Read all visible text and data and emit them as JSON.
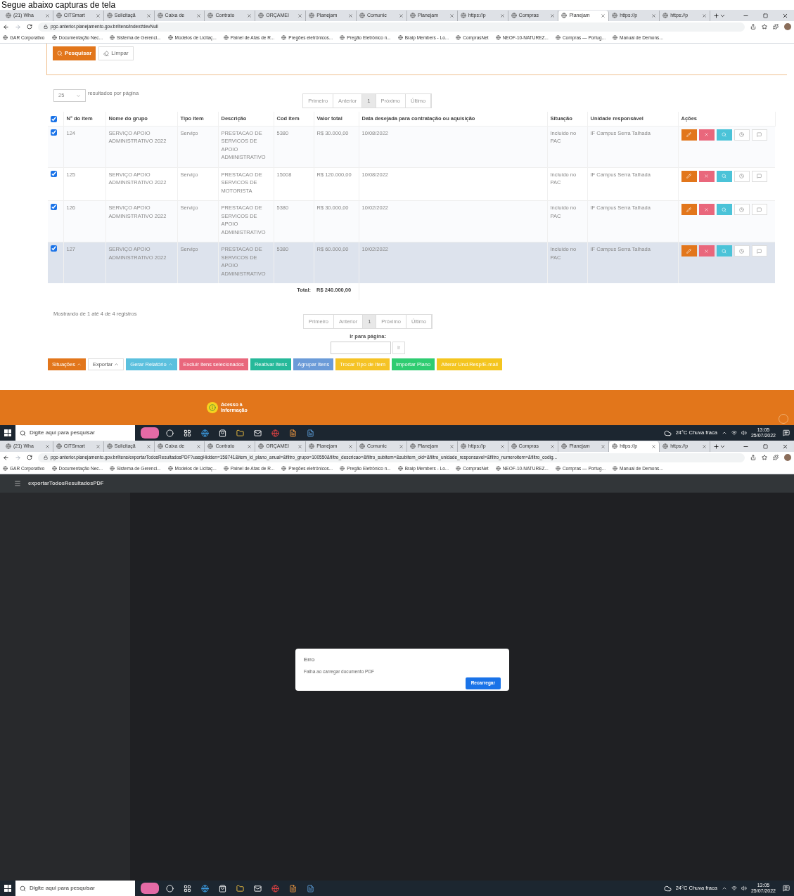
{
  "caption": "Segue abaixo capturas de tela",
  "screenshots": [
    {
      "browser": {
        "tabs": [
          {
            "label": "(21) Wha",
            "selected": false
          },
          {
            "label": "CITSmart",
            "selected": false
          },
          {
            "label": "Solicitaçã",
            "selected": false
          },
          {
            "label": "Caixa de",
            "selected": false
          },
          {
            "label": "Contrato",
            "selected": false
          },
          {
            "label": "ORÇAMEI",
            "selected": false
          },
          {
            "label": "Planejam",
            "selected": false
          },
          {
            "label": "Comunic",
            "selected": false
          },
          {
            "label": "Planejam",
            "selected": false
          },
          {
            "label": "https://p",
            "selected": false
          },
          {
            "label": "Compras",
            "selected": false
          },
          {
            "label": "Planejam",
            "selected": true
          },
          {
            "label": "https://p",
            "selected": false
          },
          {
            "label": "https://p",
            "selected": false
          }
        ],
        "url": "pgc-anterior.planejamento.gov.br/itens/index#devNull",
        "bookmarks": [
          "GAR Corporativo",
          "Documentação Nec...",
          "Sistema de Gerenci...",
          "Modelos de Licitaç...",
          "Painel de Atas de R...",
          "Pregões eletrônicos...",
          "Pregão Eletrônico n...",
          "Braip Members - Lo...",
          "ComprasNet",
          "NEOF-10-NATUREZ...",
          "Compras — Portug...",
          "Manual de Demons..."
        ]
      },
      "page": {
        "kind": "items",
        "search_buttons": [
          "Pesquisar",
          "Limpar"
        ],
        "page_size": "25",
        "page_size_label": "resultados por página",
        "pagination": [
          {
            "label": "Primeiro",
            "selected": false
          },
          {
            "label": "Anterior",
            "selected": false
          },
          {
            "label": "1",
            "selected": true
          },
          {
            "label": "Próximo",
            "selected": false
          },
          {
            "label": "Último",
            "selected": false
          }
        ],
        "table": {
          "select_all_checked": true,
          "columns": [
            "N° do item",
            "Nome do grupo",
            "Tipo item",
            "Descrição",
            "Cod item",
            "Valor total",
            "Data desejada para contratação ou aquisição",
            "Situação",
            "Unidade responsável",
            "Ações"
          ],
          "rows": [
            {
              "checked": true,
              "highlighted": false,
              "cells": [
                "124",
                "SERVIÇO APOIO ADMINISTRATIVO 2022",
                "Serviço",
                "PRESTACAO DE SERVICOS DE APOIO ADMINISTRATIVO",
                "5380",
                "R$ 30.000,00",
                "10/08/2022",
                "Incluído no PAC",
                "IF Campus Serra Talhada"
              ]
            },
            {
              "checked": true,
              "highlighted": false,
              "cells": [
                "125",
                "SERVIÇO APOIO ADMINISTRATIVO 2022",
                "Serviço",
                "PRESTACAO DE SERVICOS DE MOTORISTA",
                "15008",
                "R$ 120.000,00",
                "10/08/2022",
                "Incluído no PAC",
                "IF Campus Serra Talhada"
              ]
            },
            {
              "checked": true,
              "highlighted": false,
              "cells": [
                "126",
                "SERVIÇO APOIO ADMINISTRATIVO 2022",
                "Serviço",
                "PRESTACAO DE SERVICOS DE APOIO ADMINISTRATIVO",
                "5380",
                "R$ 30.000,00",
                "10/02/2022",
                "Incluído no PAC",
                "IF Campus Serra Talhada"
              ]
            },
            {
              "checked": true,
              "highlighted": true,
              "cells": [
                "127",
                "SERVIÇO APOIO ADMINISTRATIVO 2022",
                "Serviço",
                "PRESTACAO DE SERVICOS DE APOIO ADMINISTRATIVO",
                "5380",
                "R$ 60.000,00",
                "10/02/2022",
                "Incluído no PAC",
                "IF Campus Serra Talhada"
              ]
            }
          ],
          "total_label": "Total:",
          "total_value": "R$ 240.000,00"
        },
        "showing": "Mostrando de 1 até 4 de 4 registros",
        "pagination_bottom": [
          {
            "label": "Primeiro",
            "selected": false
          },
          {
            "label": "Anterior",
            "selected": false
          },
          {
            "label": "1",
            "selected": true
          },
          {
            "label": "Próximo",
            "selected": false
          },
          {
            "label": "Último",
            "selected": false
          }
        ],
        "goto_label": "Ir para página:",
        "goto_button": "Ir",
        "actions": [
          {
            "label": "Situações",
            "color": "#e2761b",
            "dropdown": true
          },
          {
            "label": "Exportar",
            "color": "#ffffff",
            "dropdown": true
          },
          {
            "label": "Gerar Relatório",
            "color": "#5bc0de",
            "dropdown": true
          },
          {
            "label": "Excluir itens selecionados",
            "color": "#e9677c",
            "dropdown": false
          },
          {
            "label": "Reativar Itens",
            "color": "#26b99a",
            "dropdown": false
          },
          {
            "label": "Agrupar Itens",
            "color": "#6b9bd8",
            "dropdown": false
          },
          {
            "label": "Trocar Tipo de Item",
            "color": "#f5c325",
            "dropdown": false
          },
          {
            "label": "Importar Plano",
            "color": "#2ecc71",
            "dropdown": false
          },
          {
            "label": "Alterar Und.Resp/E-mail",
            "color": "#f4c51f",
            "dropdown": false
          }
        ],
        "footer_link": "Acesso à Informação"
      },
      "taskbar": {
        "search": "Digite aqui para pesquisar",
        "weather": "24°C Chuva fraca",
        "time": "13:05",
        "date": "25/07/2022"
      }
    },
    {
      "browser": {
        "tabs": [
          {
            "label": "(21) Wha",
            "selected": false
          },
          {
            "label": "CITSmart",
            "selected": false
          },
          {
            "label": "Solicitaçã",
            "selected": false
          },
          {
            "label": "Caixa de",
            "selected": false
          },
          {
            "label": "Contrato",
            "selected": false
          },
          {
            "label": "ORÇAMEI",
            "selected": false
          },
          {
            "label": "Planejam",
            "selected": false
          },
          {
            "label": "Comunic",
            "selected": false
          },
          {
            "label": "Planejam",
            "selected": false
          },
          {
            "label": "https://p",
            "selected": false
          },
          {
            "label": "Compras",
            "selected": false
          },
          {
            "label": "Planejam",
            "selected": false
          },
          {
            "label": "https://p",
            "selected": true
          },
          {
            "label": "https://p",
            "selected": false
          }
        ],
        "url": "pgc-anterior.planejamento.gov.br/itens/exportarTodosResultadosPDF?uasgHidden=158741&item_id_plano_anual=&filtro_grupo=100550&filtro_descricao=&filtro_subitem=&subitem_old=&filtro_unidade_responsavel=&filtro_numeroitem=&filtro_codig...",
        "bookmarks": [
          "GAR Corporativo",
          "Documentação Nec...",
          "Sistema de Gerenci...",
          "Modelos de Licitaç...",
          "Painel de Atas de R...",
          "Pregões eletrônicos...",
          "Pregão Eletrônico n...",
          "Braip Members - Lo...",
          "ComprasNet",
          "NEOF-10-NATUREZ...",
          "Compras — Portug...",
          "Manual de Demons..."
        ]
      },
      "page": {
        "kind": "pdf",
        "title": "exportarTodosResultadosPDF",
        "dialog": {
          "title": "Erro",
          "message": "Falha ao carregar documento PDF",
          "button": "Recarregar"
        }
      },
      "taskbar": {
        "search": "Digite aqui para pesquisar",
        "weather": "24°C Chuva fraca",
        "time": "13:05",
        "date": "25/07/2022"
      }
    }
  ]
}
